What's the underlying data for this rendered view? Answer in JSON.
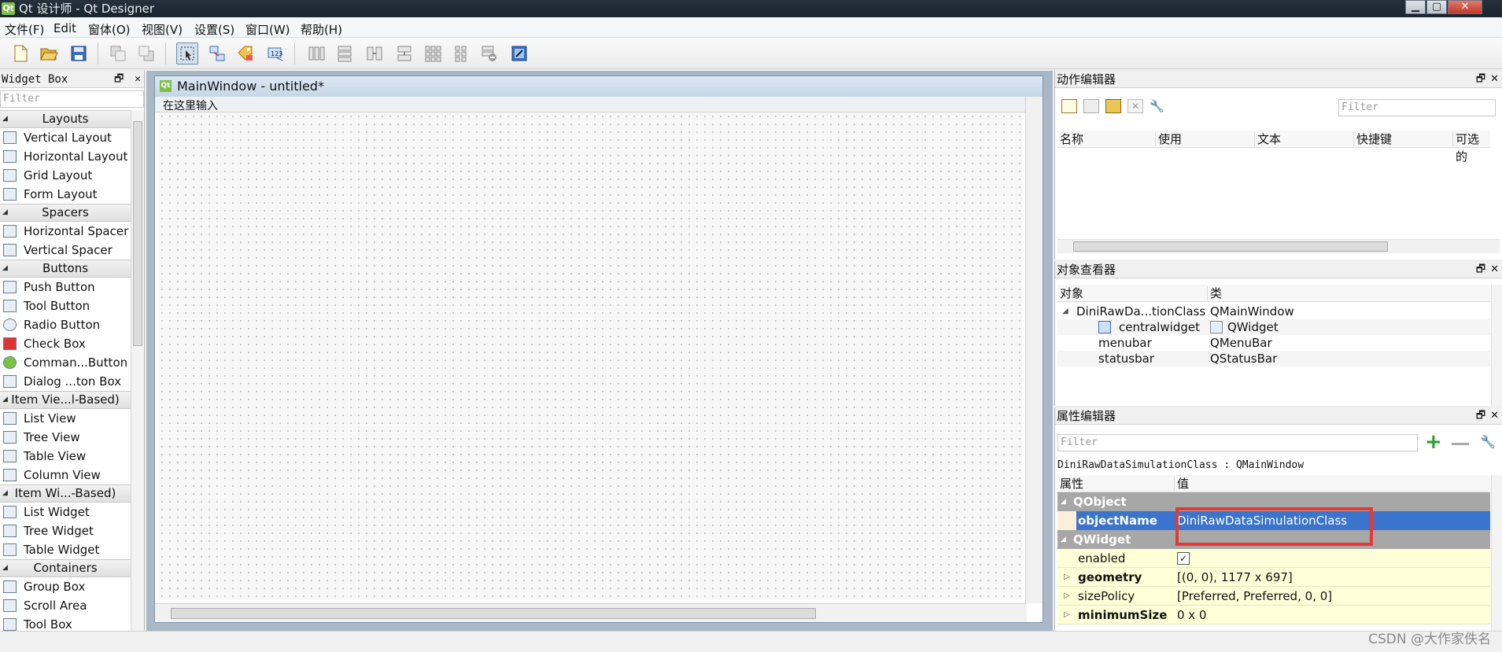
{
  "window": {
    "title": "Qt 设计师 - Qt Designer",
    "logo": "Qt"
  },
  "menubar": {
    "items": [
      "文件(F)",
      "Edit",
      "窗体(O)",
      "视图(V)",
      "设置(S)",
      "窗口(W)",
      "帮助(H)"
    ]
  },
  "toolbar": {
    "buttons": [
      "new-icon",
      "open-icon",
      "save-icon",
      "send-back-icon",
      "bring-front-icon",
      "edit-widgets-icon",
      "edit-signals-icon",
      "edit-buddies-icon",
      "edit-tab-order-icon",
      "layout-horizontal-icon",
      "layout-vertical-icon",
      "layout-h-splitter-icon",
      "layout-v-splitter-icon",
      "layout-grid-icon",
      "layout-form-icon",
      "break-layout-icon",
      "adjust-size-icon"
    ]
  },
  "widget_box": {
    "title": "Widget Box",
    "filter_placeholder": "Filter",
    "float_btn": "🗗",
    "close_btn": "✕",
    "categories": [
      {
        "name": "Layouts",
        "items": [
          "Vertical Layout",
          "Horizontal Layout",
          "Grid Layout",
          "Form Layout"
        ]
      },
      {
        "name": "Spacers",
        "items": [
          "Horizontal Spacer",
          "Vertical Spacer"
        ]
      },
      {
        "name": "Buttons",
        "items": [
          "Push Button",
          "Tool Button",
          "Radio Button",
          "Check Box",
          "Comman...Button",
          "Dialog ...ton Box"
        ]
      },
      {
        "name": "Item Vie...l-Based)",
        "items": [
          "List View",
          "Tree View",
          "Table View",
          "Column View"
        ]
      },
      {
        "name": "Item Wi...-Based)",
        "items": [
          "List Widget",
          "Tree Widget",
          "Table Widget"
        ]
      },
      {
        "name": "Containers",
        "items": [
          "Group Box",
          "Scroll Area",
          "Tool Box"
        ]
      }
    ]
  },
  "form": {
    "title": "MainWindow - untitled*",
    "logo": "Qt",
    "menu_placeholder": "在这里输入"
  },
  "action_editor": {
    "title": "动作编辑器",
    "filter_placeholder": "Filter",
    "columns": [
      "名称",
      "使用",
      "文本",
      "快捷键",
      "可选的"
    ]
  },
  "object_inspector": {
    "title": "对象查看器",
    "columns": [
      "对象",
      "类"
    ],
    "rows": [
      {
        "object": "DiniRawDa...tionClass",
        "class": "QMainWindow"
      },
      {
        "object": "centralwidget",
        "class": "QWidget"
      },
      {
        "object": "menubar",
        "class": "QMenuBar"
      },
      {
        "object": "statusbar",
        "class": "QStatusBar"
      }
    ]
  },
  "property_editor": {
    "title": "属性编辑器",
    "filter_placeholder": "Filter",
    "context": "DiniRawDataSimulationClass : QMainWindow",
    "columns": [
      "属性",
      "值"
    ],
    "groups": [
      "QObject",
      "QWidget"
    ],
    "object_name": {
      "prop": "objectName",
      "value": "DiniRawDataSimulationClass"
    },
    "enabled": {
      "prop": "enabled",
      "value": "✓"
    },
    "geometry": {
      "prop": "geometry",
      "value": "[(0, 0), 1177 x 697]"
    },
    "size_policy": {
      "prop": "sizePolicy",
      "value": "[Preferred, Preferred, 0, 0]"
    },
    "minimum_size": {
      "prop": "minimumSize",
      "value": "0 x 0"
    },
    "highlight_color": "#e53935"
  },
  "watermark": "CSDN @大作家佚名"
}
